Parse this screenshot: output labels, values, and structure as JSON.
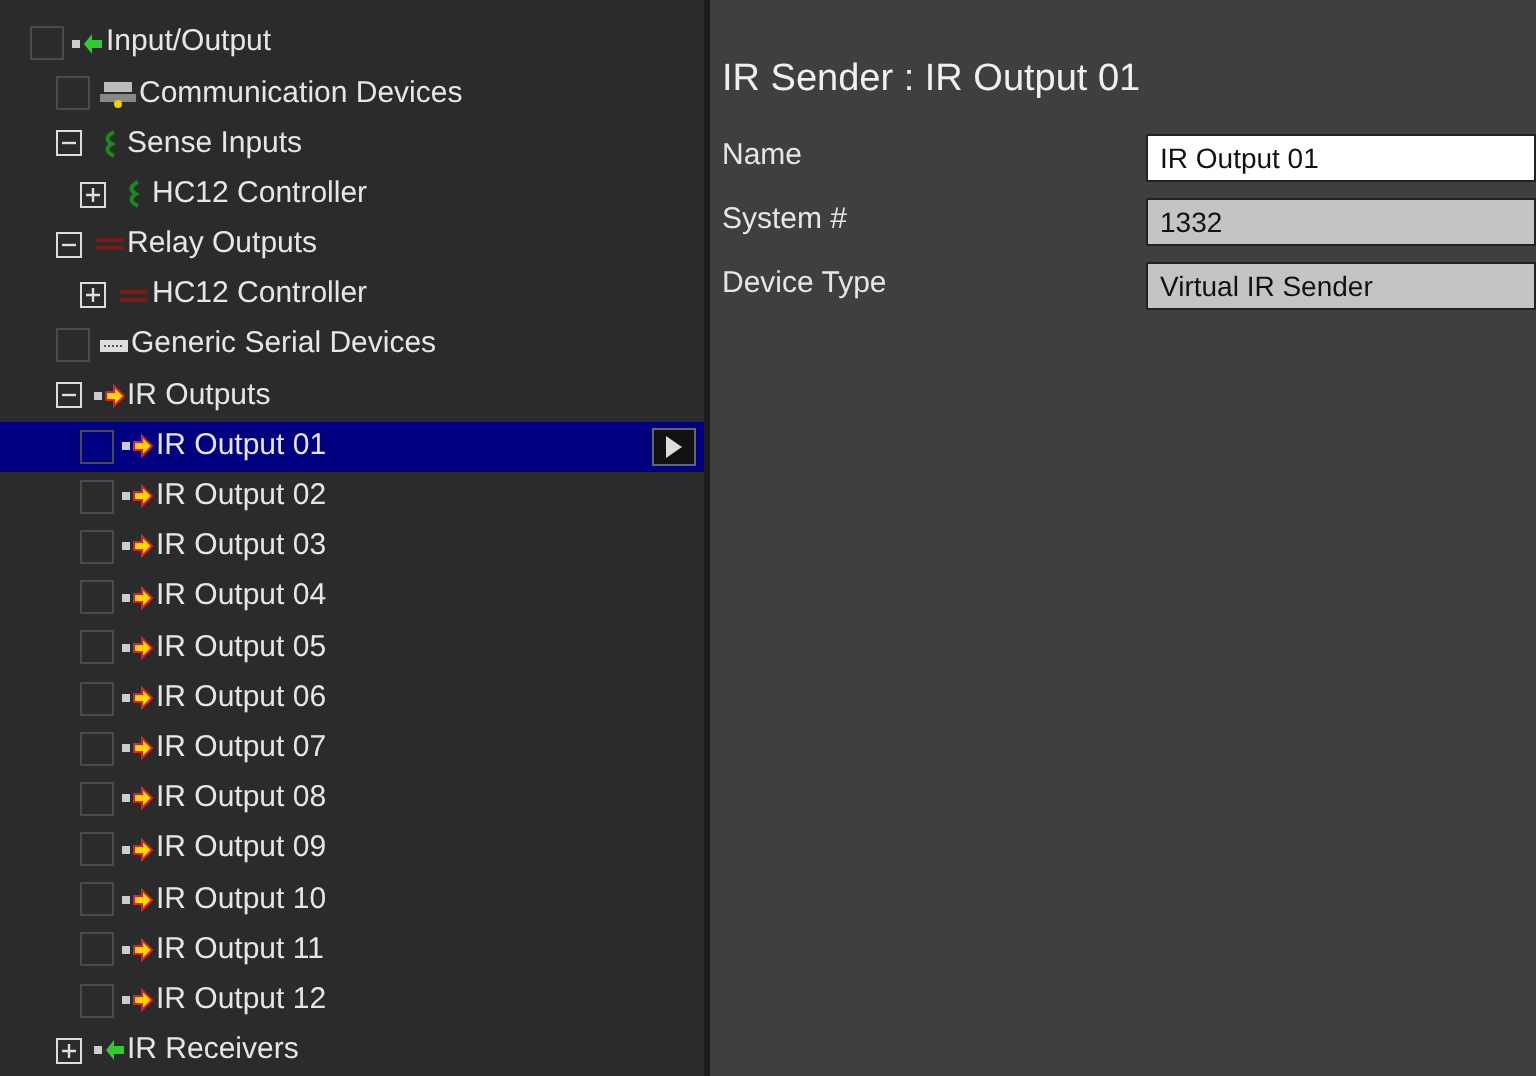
{
  "tree": [
    {
      "label": "Input/Output",
      "kind": "input",
      "checked": false,
      "selected": false,
      "children": [
        {
          "label": "Communication Devices",
          "kind": "network",
          "checked": false,
          "selected": false
        },
        {
          "label": "Sense Inputs",
          "kind": "sense",
          "expanded": true,
          "selected": false,
          "children": [
            {
              "label": "HC12 Controller",
              "kind": "sense",
              "expanded": false,
              "selected": false
            }
          ]
        },
        {
          "label": "Relay Outputs",
          "kind": "relay",
          "expanded": true,
          "selected": false,
          "children": [
            {
              "label": "HC12 Controller",
              "kind": "relay",
              "expanded": false,
              "selected": false
            }
          ]
        },
        {
          "label": "Generic Serial Devices",
          "kind": "serial",
          "checked": false,
          "selected": false
        },
        {
          "label": "IR Outputs",
          "kind": "output",
          "expanded": true,
          "selected": false,
          "children": [
            {
              "label": "IR Output 01",
              "kind": "output",
              "checked": false,
              "selected": true
            },
            {
              "label": "IR Output 02",
              "kind": "output",
              "checked": false,
              "selected": false
            },
            {
              "label": "IR Output 03",
              "kind": "output",
              "checked": false,
              "selected": false
            },
            {
              "label": "IR Output 04",
              "kind": "output",
              "checked": false,
              "selected": false
            },
            {
              "label": "IR Output 05",
              "kind": "output",
              "checked": false,
              "selected": false
            },
            {
              "label": "IR Output 06",
              "kind": "output",
              "checked": false,
              "selected": false
            },
            {
              "label": "IR Output 07",
              "kind": "output",
              "checked": false,
              "selected": false
            },
            {
              "label": "IR Output 08",
              "kind": "output",
              "checked": false,
              "selected": false
            },
            {
              "label": "IR Output 09",
              "kind": "output",
              "checked": false,
              "selected": false
            },
            {
              "label": "IR Output 10",
              "kind": "output",
              "checked": false,
              "selected": false
            },
            {
              "label": "IR Output 11",
              "kind": "output",
              "checked": false,
              "selected": false
            },
            {
              "label": "IR Output 12",
              "kind": "output",
              "checked": false,
              "selected": false
            }
          ]
        },
        {
          "label": "IR Receivers",
          "kind": "input",
          "expanded": false,
          "selected": false
        }
      ]
    }
  ],
  "detail": {
    "title": "IR Sender : IR Output 01",
    "fields": [
      {
        "label": "Name",
        "value": "IR Output 01",
        "readonly": false
      },
      {
        "label": "System #",
        "value": "1332",
        "readonly": true
      },
      {
        "label": "Device Type",
        "value": "Virtual IR Sender",
        "readonly": true
      }
    ]
  }
}
